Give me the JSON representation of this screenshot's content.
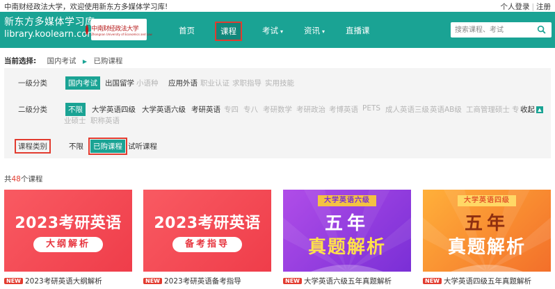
{
  "topbar": {
    "welcome": "中南财经政法大学，欢迎使用新东方多媒体学习库!",
    "login": "个人登录",
    "sep": "|",
    "register": "注册"
  },
  "header": {
    "brand_name": "新东方多媒体学习库",
    "brand_url": "library.koolearn.com",
    "partner_name": "中南财经政法大学",
    "partner_sub": "Zhongnan University of Economics and Law",
    "nav": {
      "home": "首页",
      "course": "课程",
      "exam": "考试",
      "news": "资讯",
      "live": "直播课"
    },
    "search_placeholder": "搜索课程、考试"
  },
  "breadcrumb": {
    "label": "当前选择:",
    "level1": "国内考试",
    "level2": "已购课程"
  },
  "filters": {
    "row1": {
      "label": "一级分类",
      "options": [
        "国内考试",
        "出国留学",
        "小语种",
        "应用外语",
        "职业认证",
        "求职指导",
        "实用技能"
      ]
    },
    "row2": {
      "label": "二级分类",
      "options": [
        "不限",
        "大学英语四级",
        "大学英语六级",
        "考研英语",
        "专四",
        "专八",
        "考研数学",
        "考研政治",
        "考博英语",
        "PETS",
        "成人英语三级",
        "英语AB级",
        "工商管理硕士",
        "专",
        "业硕士",
        "职称英语"
      ],
      "collapse": "收起"
    },
    "row3": {
      "label": "课程类别",
      "options": [
        "不限",
        "已购课程",
        "试听课程"
      ]
    }
  },
  "summary": {
    "prefix": "共",
    "count": "48",
    "suffix": "个课程"
  },
  "cards": [
    {
      "big": "2023考研英语",
      "pill": "大纲解析",
      "badge": "NEW",
      "title": "2023考研英语大纲解析"
    },
    {
      "big": "2023考研英语",
      "pill": "备考指导",
      "badge": "NEW",
      "title": "2023考研英语备考指导"
    },
    {
      "ribbon": "大学英语六级",
      "line1": "五年",
      "line2": "真题解析",
      "badge": "NEW",
      "title": "大学英语六级五年真题解析"
    },
    {
      "ribbon": "大学英语四级",
      "line1": "五年",
      "line2": "真题解析",
      "badge": "NEW",
      "title": "大学英语四级五年真题解析"
    }
  ],
  "colors": {
    "brand": "#1aa394",
    "highlight": "#e23b2f"
  }
}
